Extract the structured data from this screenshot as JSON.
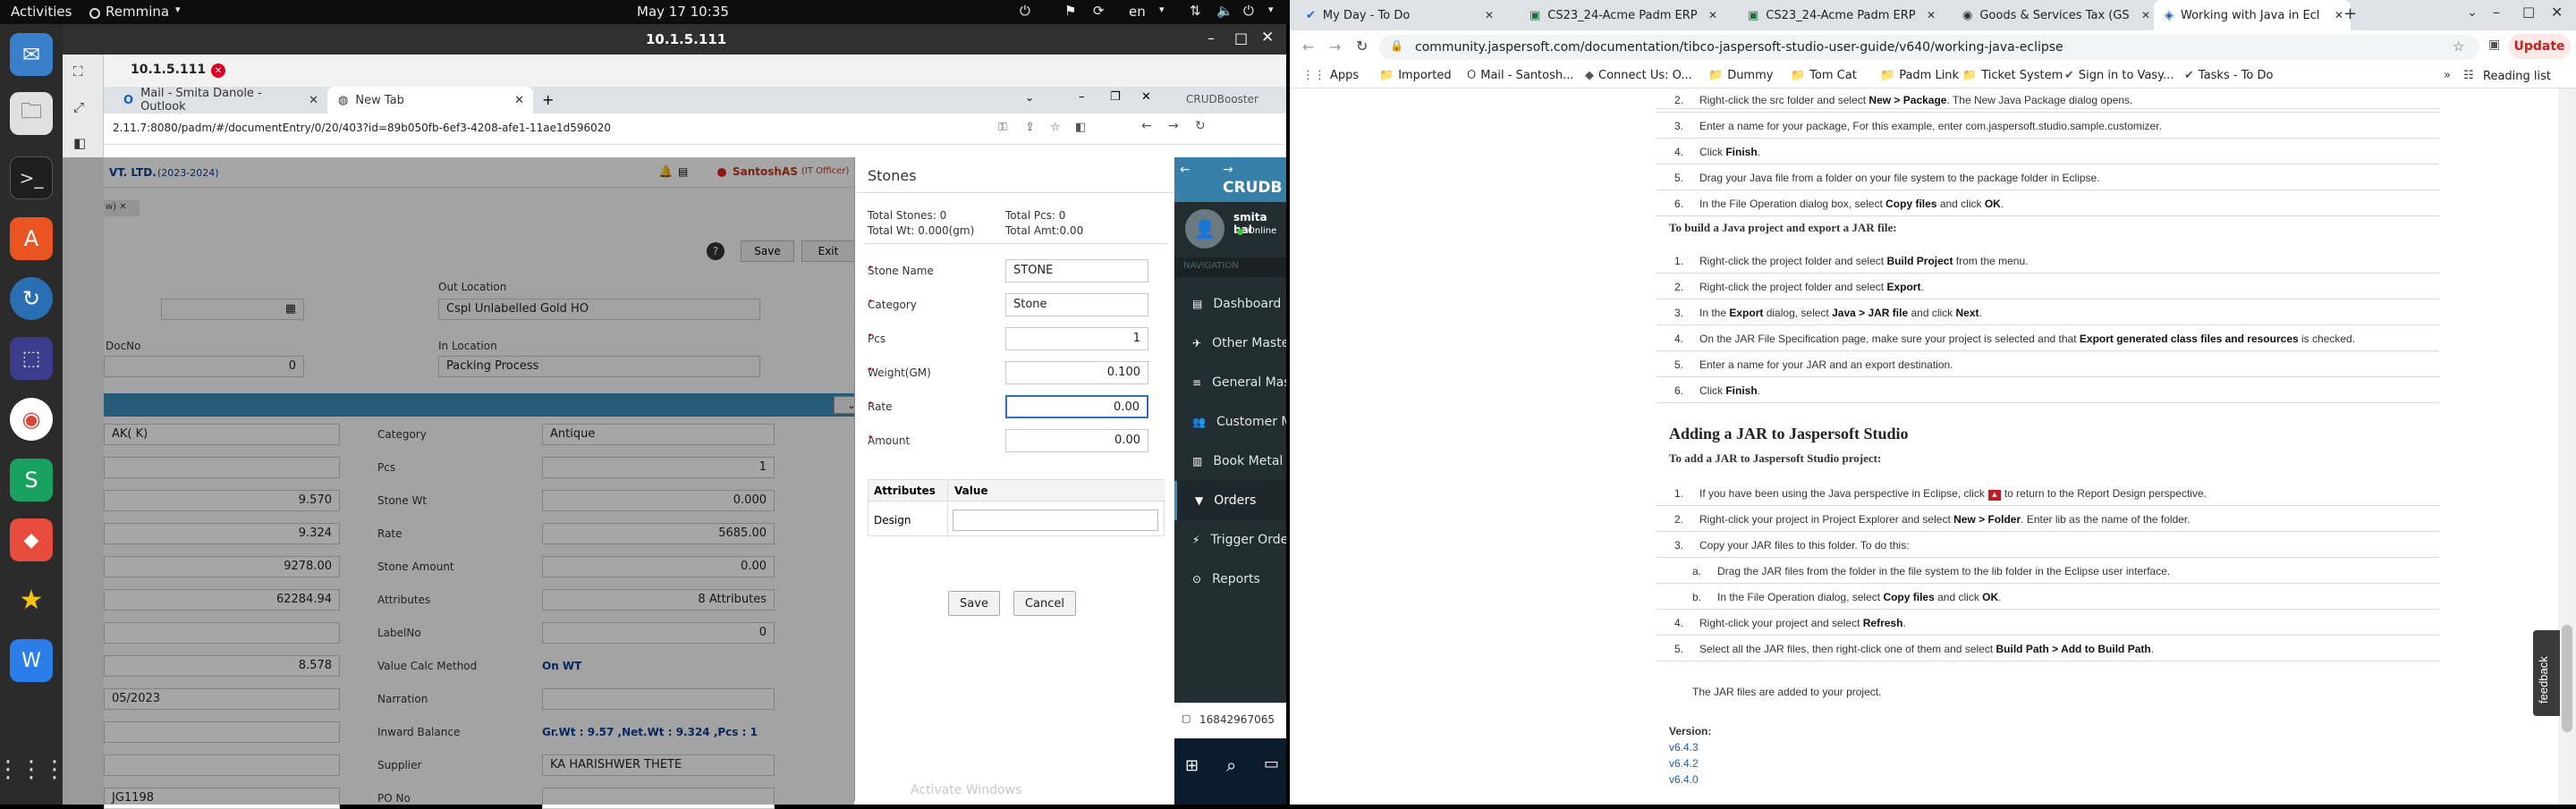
{
  "topbar": {
    "activities": "Activities",
    "app": "Remmina",
    "clock": "May 17  10:35",
    "lang": "en"
  },
  "remmina": {
    "title": "10.1.5.111",
    "tab_label": "10.1.5.111"
  },
  "inner_browser": {
    "tabs": [
      "Mail - Smita Danole - Outlook",
      "New Tab"
    ],
    "url": "2.11.7:8080/padm/#/documentEntry/0/20/403?id=89b050fb-6ef3-4208-afe1-11ae1d596020",
    "right_tab": "CRUDBooster"
  },
  "erp": {
    "company": "VT. LTD.",
    "year": "(2023-2024)",
    "user": "SantoshAS",
    "role": "(IT Officer)",
    "save": "Save",
    "exit": "Exit",
    "out_location_label": "Out Location",
    "out_location": "Cspl Unlabelled Gold HO",
    "docno_label": "DocNo",
    "docno": "0",
    "in_location_label": "In Location",
    "in_location": "Packing Process",
    "rows": [
      {
        "left": "AK( K)",
        "label": "Category",
        "value": "Antique"
      },
      {
        "left": "",
        "label": "Pcs",
        "value": "1"
      },
      {
        "left": "9.570",
        "label": "Stone Wt",
        "value": "0.000"
      },
      {
        "left": "9.324",
        "label": "Rate",
        "value": "5685.00"
      },
      {
        "left": "9278.00",
        "label": "Stone Amount",
        "value": "0.00"
      },
      {
        "left": "62284.94",
        "label": "Attributes",
        "value": "8 Attributes"
      },
      {
        "left": "",
        "label": "LabelNo",
        "value": "0"
      },
      {
        "left": "8.578",
        "label": "Value Calc Method",
        "value": "On WT"
      },
      {
        "left": "05/2023",
        "label": "Narration",
        "value": ""
      },
      {
        "left": "",
        "label": "Inward Balance",
        "value": "Gr.Wt : 9.57 ,Net.Wt : 9.324 ,Pcs : 1"
      },
      {
        "left": "",
        "label": "Supplier",
        "value": "KA HARISHWER THETE"
      },
      {
        "left": "JG1198",
        "label": "PO No",
        "value": ""
      }
    ]
  },
  "stones_modal": {
    "title": "Stones",
    "total_stones": "Total Stones: 0",
    "total_pcs": "Total Pcs: 0",
    "total_wt": "Total Wt: 0.000(gm)",
    "total_amt": "Total Amt:0.00",
    "fields": [
      {
        "label": "Stone Name",
        "value": "STONE"
      },
      {
        "label": "Category",
        "value": "Stone"
      },
      {
        "label": "Pcs",
        "value": "1"
      },
      {
        "label": "Weight(GM)",
        "value": "0.100"
      },
      {
        "label": "Rate",
        "value": "0.00"
      },
      {
        "label": "Amount",
        "value": "0.00"
      }
    ],
    "attr_header": "Attributes",
    "value_header": "Value",
    "attr_row": "Design",
    "save": "Save",
    "cancel": "Cancel",
    "watermark": "Activate Windows"
  },
  "crud_sidebar": {
    "brand": "CRUDB",
    "user": "smita bal",
    "status": "Online",
    "nav_header": "NAVIGATION",
    "items": [
      "Dashboard",
      "Other Masters",
      "General Master",
      "Customer Mast",
      "Book Metal",
      "Orders",
      "Trigger Orders",
      "Reports"
    ],
    "footer_number": "16842967065"
  },
  "chrome": {
    "tabs": [
      "My Day - To Do",
      "CS23_24-Acme Padm ERP",
      "CS23_24-Acme Padm ERP",
      "Goods & Services Tax (GS",
      "Working with Java in Ecl"
    ],
    "url": "community.jaspersoft.com/documentation/tibco-jaspersoft-studio-user-guide/v640/working-java-eclipse",
    "update": "Update",
    "bookmarks": [
      "Apps",
      "Imported",
      "Mail - Santosh...",
      "Connect Us: O...",
      "Dummy",
      "Tom Cat",
      "Padm Link",
      "Ticket System",
      "Sign in to Vasy...",
      "Tasks - To Do"
    ],
    "reading_list": "Reading list"
  },
  "article": {
    "steps_top": [
      "Right-click the src folder and select New > Package. The New Java Package dialog opens.",
      "Enter a name for your package, For this example, enter com.jaspersoft.studio.sample.customizer.",
      "Click Finish.",
      "Drag your Java file from a folder on your file system to the package folder in Eclipse.",
      "In the File Operation dialog box, select Copy files and click OK."
    ],
    "build_heading": "To build a Java project and export a JAR file:",
    "build_steps": [
      "Right-click the project folder and select Build Project from the menu.",
      "Right-click the project folder and select Export.",
      "In the Export dialog, select Java > JAR file and click Next.",
      "On the JAR File Specification page, make sure your project is selected and that Export generated class files and resources is checked.",
      "Enter a name for your JAR and an export destination.",
      "Click Finish."
    ],
    "h2": "Adding a JAR to Jaspersoft Studio",
    "add_heading": "To add a JAR to Jaspersoft Studio project:",
    "add_steps": [
      "If you have been using the Java perspective in Eclipse, click",
      "to return to the Report Design perspective.",
      "Right-click your project in Project Explorer and select New > Folder. Enter lib as the name of the folder.",
      "Copy your JAR files to this folder. To do this:",
      "Drag the JAR files from the folder in the file system to the lib folder in the Eclipse user interface.",
      "In the File Operation dialog, select Copy files and click OK.",
      "Right-click your project and select Refresh.",
      "Select all the JAR files, then right-click one of them and select Build Path > Add to Build Path."
    ],
    "closing": "The JAR files are added to your project.",
    "version_label": "Version:",
    "versions": [
      "v6.4.3",
      "v6.4.2",
      "v6.4.0"
    ],
    "feedback": "feedback"
  }
}
